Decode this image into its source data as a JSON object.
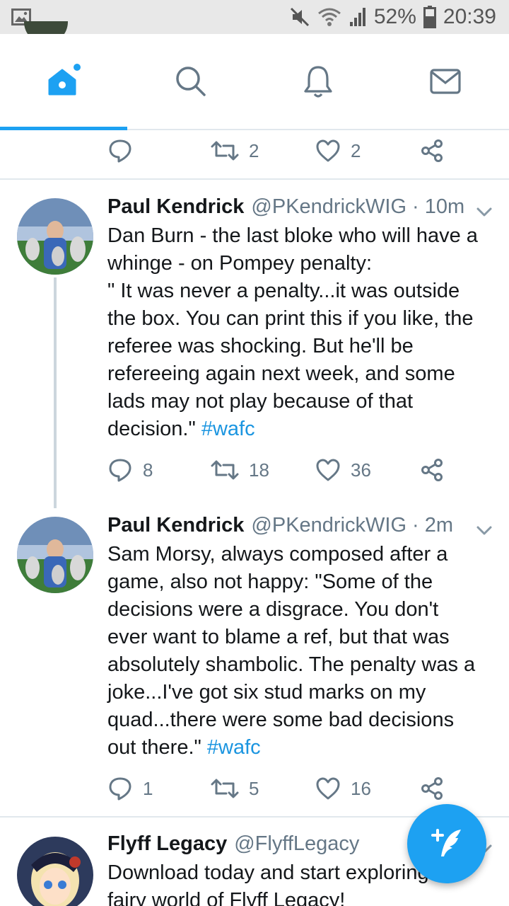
{
  "status_bar": {
    "battery": "52%",
    "time": "20:39"
  },
  "nav": {
    "tabs": [
      "home-tab",
      "search-tab",
      "notifications-tab",
      "messages-tab"
    ],
    "active": "home-tab"
  },
  "colors": {
    "accent": "#1da1f2",
    "link": "#1b95e0",
    "muted": "#657786",
    "divider": "#e1e8ed"
  },
  "top_actions": {
    "replies": "",
    "retweets": "2",
    "likes": "2"
  },
  "tweets": [
    {
      "name": "Paul Kendrick",
      "handle": "@PKendrickWIG",
      "dot": "·",
      "time": "10m",
      "text_lines": [
        "Dan Burn - the last bloke who will have a",
        "whinge - on Pompey penalty:",
        "\" It was never a penalty...it was outside",
        "the box. You can print this if you like, the",
        "referee was shocking. But he'll be",
        "refereeing again next week, and some",
        "lads may not play because of that"
      ],
      "last_line": "decision.\"",
      "hashtag": "#wafc",
      "replies": "8",
      "retweets": "18",
      "likes": "36"
    },
    {
      "name": "Paul Kendrick",
      "handle": "@PKendrickWIG",
      "dot": "·",
      "time": "2m",
      "text_lines": [
        "Sam Morsy, always composed after a",
        "game, also not happy: \"Some of the",
        "decisions were a disgrace. You don't",
        "ever want to blame a ref, but that was",
        "absolutely shambolic. The penalty was a",
        "joke...I've got six stud marks on my",
        "quad...there were some bad decisions"
      ],
      "last_line": "out there.\"",
      "hashtag": "#wafc",
      "replies": "1",
      "retweets": "5",
      "likes": "16"
    },
    {
      "name": "Flyff Legacy",
      "handle": "@FlyffLegacy",
      "text_lines": [
        "Download today and start exploring the",
        "fairy world of Flyff Legacy!"
      ]
    }
  ]
}
